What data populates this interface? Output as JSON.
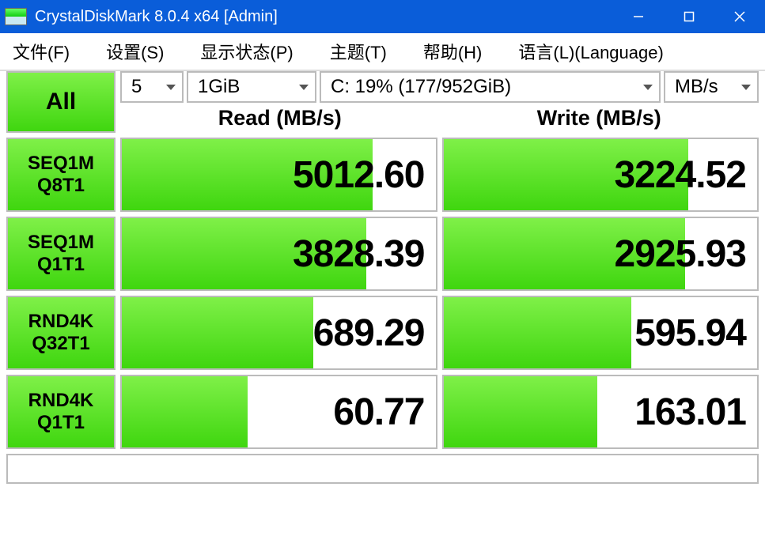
{
  "window": {
    "title": "CrystalDiskMark 8.0.4 x64 [Admin]"
  },
  "menu": {
    "file": "文件(F)",
    "settings": "设置(S)",
    "display": "显示状态(P)",
    "theme": "主题(T)",
    "help": "帮助(H)",
    "language": "语言(L)(Language)"
  },
  "controls": {
    "all_label": "All",
    "count": "5",
    "size": "1GiB",
    "drive": "C: 19% (177/952GiB)",
    "unit": "MB/s"
  },
  "headers": {
    "read": "Read (MB/s)",
    "write": "Write (MB/s)"
  },
  "rows": [
    {
      "label1": "SEQ1M",
      "label2": "Q8T1",
      "read": "5012.60",
      "read_bar": 80,
      "write": "3224.52",
      "write_bar": 78
    },
    {
      "label1": "SEQ1M",
      "label2": "Q1T1",
      "read": "3828.39",
      "read_bar": 78,
      "write": "2925.93",
      "write_bar": 77
    },
    {
      "label1": "RND4K",
      "label2": "Q32T1",
      "read": "689.29",
      "read_bar": 61,
      "write": "595.94",
      "write_bar": 60
    },
    {
      "label1": "RND4K",
      "label2": "Q1T1",
      "read": "60.77",
      "read_bar": 40,
      "write": "163.01",
      "write_bar": 49
    }
  ]
}
